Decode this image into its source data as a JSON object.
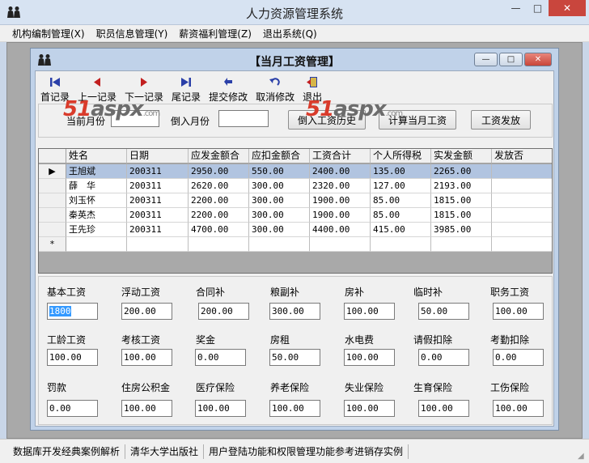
{
  "app": {
    "title": "人力资源管理系统",
    "controls": {
      "minimize": "—",
      "maximize": "□",
      "close": "✕"
    }
  },
  "menu": [
    "机构编制管理(X)",
    "职员信息管理(Y)",
    "薪资福利管理(Z)",
    "退出系统(Q)"
  ],
  "child": {
    "title": "【当月工资管理】",
    "controls": {
      "minimize": "—",
      "maximize": "□",
      "close": "✕"
    }
  },
  "toolbar": [
    {
      "label": "首记录",
      "icon": "first-record-icon",
      "color": "#2a3fa8"
    },
    {
      "label": "上一记录",
      "icon": "prev-record-icon",
      "color": "#c22020"
    },
    {
      "label": "下一记录",
      "icon": "next-record-icon",
      "color": "#c22020"
    },
    {
      "label": "尾记录",
      "icon": "last-record-icon",
      "color": "#2a3fa8"
    },
    {
      "label": "提交修改",
      "icon": "submit-icon",
      "color": "#2a3fa8"
    },
    {
      "label": "取消修改",
      "icon": "undo-icon",
      "color": "#2a3fa8"
    },
    {
      "label": "退出",
      "icon": "exit-icon",
      "color": "#c22020"
    }
  ],
  "month": {
    "current_label": "当前月份",
    "current_value": "",
    "import_label": "倒入月份",
    "import_value": "",
    "btn_history": "倒入工资历史",
    "btn_calc": "计算当月工资",
    "btn_pay": "工资发放"
  },
  "watermark": {
    "brand_red": "51",
    "brand_grey": "aspx",
    "suffix": ".com"
  },
  "grid": {
    "columns": [
      "姓名",
      "日期",
      "应发金额合",
      "应扣金额合",
      "工资合计",
      "个人所得税",
      "实发金额",
      "发放否"
    ],
    "current_marker": "▶",
    "new_marker": "*",
    "rows": [
      [
        "王旭斌",
        "200311",
        "2950.00",
        "550.00",
        "2400.00",
        "135.00",
        "2265.00",
        ""
      ],
      [
        "薛　华",
        "200311",
        "2620.00",
        "300.00",
        "2320.00",
        "127.00",
        "2193.00",
        ""
      ],
      [
        "刘玉怀",
        "200311",
        "2200.00",
        "300.00",
        "1900.00",
        "85.00",
        "1815.00",
        ""
      ],
      [
        "秦英杰",
        "200311",
        "2200.00",
        "300.00",
        "1900.00",
        "85.00",
        "1815.00",
        ""
      ],
      [
        "王先珍",
        "200311",
        "4700.00",
        "300.00",
        "4400.00",
        "415.00",
        "3985.00",
        ""
      ]
    ]
  },
  "fields": [
    {
      "label": "基本工资",
      "value": "1800"
    },
    {
      "label": "浮动工资",
      "value": "200.00"
    },
    {
      "label": "合同补",
      "value": "200.00"
    },
    {
      "label": "粮副补",
      "value": "300.00"
    },
    {
      "label": "房补",
      "value": "100.00"
    },
    {
      "label": "临时补",
      "value": "50.00"
    },
    {
      "label": "职务工资",
      "value": "100.00"
    },
    {
      "label": "工龄工资",
      "value": "100.00"
    },
    {
      "label": "考核工资",
      "value": "100.00"
    },
    {
      "label": "奖金",
      "value": "0.00"
    },
    {
      "label": "房租",
      "value": "50.00"
    },
    {
      "label": "水电费",
      "value": "100.00"
    },
    {
      "label": "请假扣除",
      "value": "0.00"
    },
    {
      "label": "考勤扣除",
      "value": "0.00"
    },
    {
      "label": "罚款",
      "value": "0.00"
    },
    {
      "label": "住房公积金",
      "value": "100.00"
    },
    {
      "label": "医疗保险",
      "value": "100.00"
    },
    {
      "label": "养老保险",
      "value": "100.00"
    },
    {
      "label": "失业保险",
      "value": "100.00"
    },
    {
      "label": "生育保险",
      "value": "100.00"
    },
    {
      "label": "工伤保险",
      "value": "100.00"
    }
  ],
  "statusbar": [
    "数据库开发经典案例解析",
    "清华大学出版社",
    "用户登陆功能和权限管理功能参考进销存实例"
  ]
}
